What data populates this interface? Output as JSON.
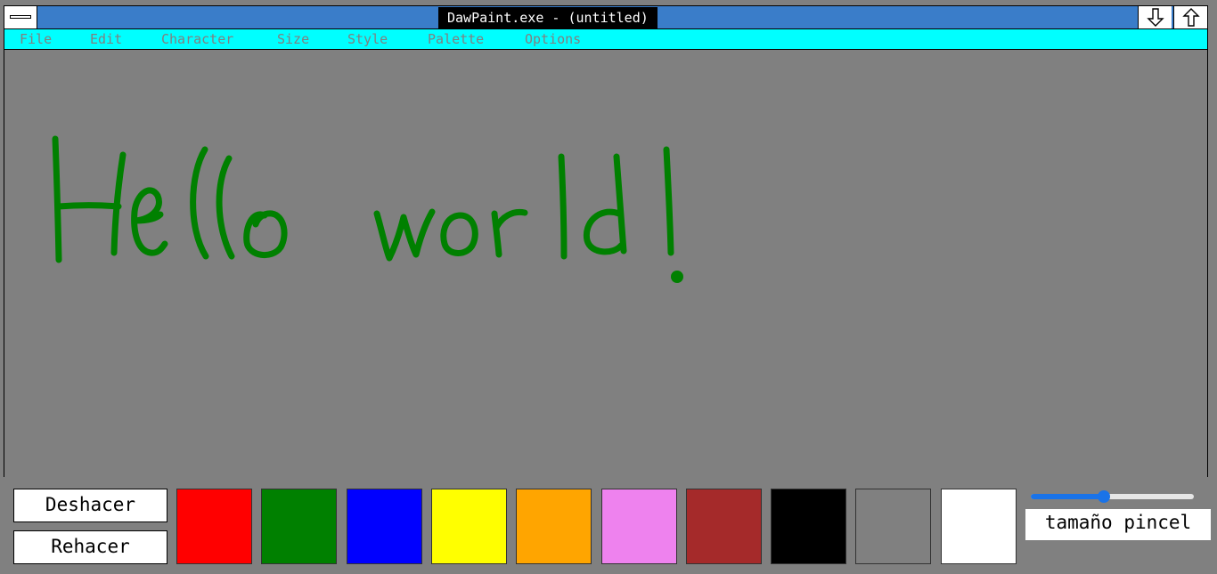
{
  "window": {
    "title": "DawPaint.exe - (untitled)",
    "minimize_icon": "arrow-down-icon",
    "maximize_icon": "arrow-up-icon"
  },
  "menu": [
    {
      "label": "File"
    },
    {
      "label": "Edit"
    },
    {
      "label": "Character"
    },
    {
      "label": "Size"
    },
    {
      "label": "Style"
    },
    {
      "label": "Palette"
    },
    {
      "label": "Options"
    }
  ],
  "canvas": {
    "background": "#808080",
    "drawing": {
      "text": "Hello world!",
      "color": "#008000"
    }
  },
  "toolbar": {
    "undo_label": "Deshacer",
    "redo_label": "Rehacer",
    "palette": [
      {
        "name": "red",
        "color": "#ff0000"
      },
      {
        "name": "green",
        "color": "#008000"
      },
      {
        "name": "blue",
        "color": "#0000ff"
      },
      {
        "name": "yellow",
        "color": "#ffff00"
      },
      {
        "name": "orange",
        "color": "#ffa500"
      },
      {
        "name": "violet",
        "color": "#ee82ee"
      },
      {
        "name": "brown",
        "color": "#a52a2a"
      },
      {
        "name": "black",
        "color": "#000000"
      },
      {
        "name": "gray",
        "color": "#808080"
      },
      {
        "name": "white",
        "color": "#ffffff"
      }
    ],
    "brush_size": {
      "label": "tamaño pincel",
      "value_fraction": 0.45
    }
  },
  "colors": {
    "titlebar": "#3a7dc9",
    "menubar": "#00ffff",
    "menu_text": "#808080",
    "slider_accent": "#1a73e8"
  }
}
